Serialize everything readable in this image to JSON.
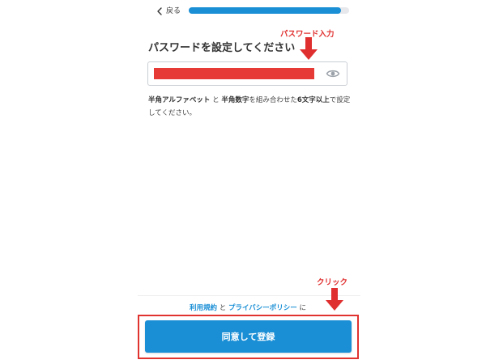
{
  "header": {
    "back_label": "戻る",
    "progress": 0.95
  },
  "main": {
    "title": "パスワードを設定してください",
    "password_field": {
      "value": "",
      "redacted": true,
      "toggle_icon": "eye-icon"
    },
    "hint": {
      "part1_bold": "半角アルファベット",
      "part2": " と ",
      "part3_bold": "半角数字",
      "part4": "を組み合わせた",
      "part5_bold": "6文字以上",
      "part6": "で設定してください。"
    }
  },
  "annotations": {
    "password_label": "パスワード入力",
    "click_label": "クリック",
    "color": "#e02f2f"
  },
  "footer": {
    "terms_link": "利用規約",
    "and_text": " と ",
    "privacy_link": "プライバシーポリシー",
    "suffix": " に",
    "submit_label": "同意して登録"
  },
  "colors": {
    "accent": "#1a8fd6",
    "redaction": "#e63a36",
    "highlight": "#e0332f"
  }
}
